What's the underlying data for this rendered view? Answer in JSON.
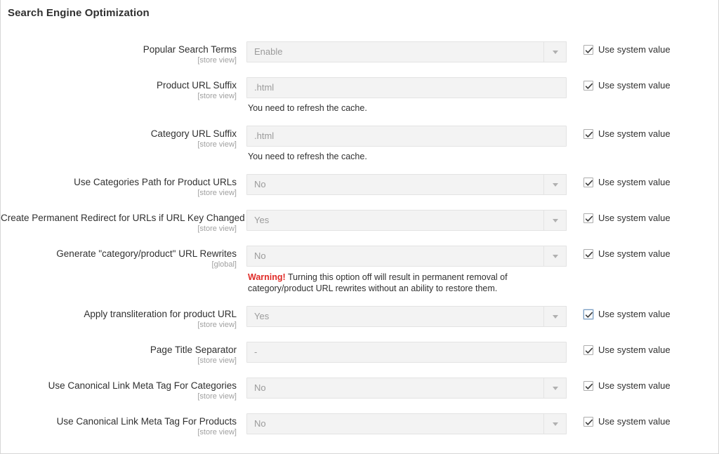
{
  "section": {
    "title": "Search Engine Optimization"
  },
  "common": {
    "system_value_label": "Use system value",
    "cache_note": "You need to refresh the cache.",
    "scope_store_view": "[store view]",
    "scope_global": "[global]",
    "warning_prefix": "Warning!",
    "dropdown_icon": "chevron-down-icon",
    "check_icon": "check-icon"
  },
  "colors": {
    "warning_red": "#e02b27",
    "text": "#303030",
    "muted": "#9b9b9b",
    "field_bg": "#f3f3f3",
    "field_border": "#e3e3e3"
  },
  "fields": [
    {
      "label": "Popular Search Terms",
      "scope": "[store view]",
      "type": "select",
      "value": "Enable",
      "note": "",
      "warning": "",
      "use_system_value": true,
      "focused": false
    },
    {
      "label": "Product URL Suffix",
      "scope": "[store view]",
      "type": "text",
      "value": ".html",
      "note": "You need to refresh the cache.",
      "warning": "",
      "use_system_value": true,
      "focused": false
    },
    {
      "label": "Category URL Suffix",
      "scope": "[store view]",
      "type": "text",
      "value": ".html",
      "note": "You need to refresh the cache.",
      "warning": "",
      "use_system_value": true,
      "focused": false
    },
    {
      "label": "Use Categories Path for Product URLs",
      "scope": "[store view]",
      "type": "select",
      "value": "No",
      "note": "",
      "warning": "",
      "use_system_value": true,
      "focused": false
    },
    {
      "label": "Create Permanent Redirect for URLs if URL Key Changed",
      "scope": "[store view]",
      "type": "select",
      "value": "Yes",
      "note": "",
      "warning": "",
      "use_system_value": true,
      "focused": false
    },
    {
      "label": "Generate \"category/product\" URL Rewrites",
      "scope": "[global]",
      "type": "select",
      "value": "No",
      "note": "",
      "warning": "Turning this option off will result in permanent removal of category/product URL rewrites without an ability to restore them.",
      "use_system_value": true,
      "focused": false
    },
    {
      "label": "Apply transliteration for product URL",
      "scope": "[store view]",
      "type": "select",
      "value": "Yes",
      "note": "",
      "warning": "",
      "use_system_value": true,
      "focused": true
    },
    {
      "label": "Page Title Separator",
      "scope": "[store view]",
      "type": "text",
      "value": "-",
      "note": "",
      "warning": "",
      "use_system_value": true,
      "focused": false
    },
    {
      "label": "Use Canonical Link Meta Tag For Categories",
      "scope": "[store view]",
      "type": "select",
      "value": "No",
      "note": "",
      "warning": "",
      "use_system_value": true,
      "focused": false
    },
    {
      "label": "Use Canonical Link Meta Tag For Products",
      "scope": "[store view]",
      "type": "select",
      "value": "No",
      "note": "",
      "warning": "",
      "use_system_value": true,
      "focused": false
    }
  ]
}
